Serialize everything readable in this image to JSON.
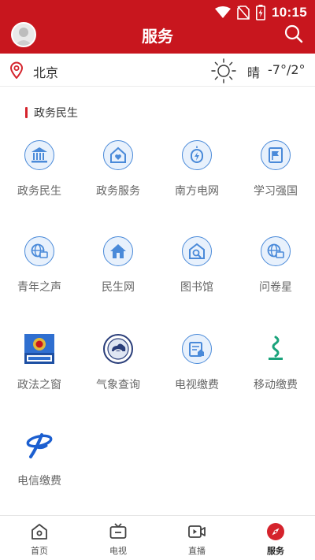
{
  "status_bar": {
    "time": "10:15",
    "icons": [
      "wifi-icon",
      "no-sim-icon",
      "battery-charging-icon"
    ]
  },
  "header": {
    "title": "服务",
    "avatar_icon": "avatar",
    "search_icon": "search-icon",
    "color": "#c8161e"
  },
  "weather": {
    "city": "北京",
    "condition": "晴",
    "temperature": "-7°/2°",
    "icon": "sun-icon"
  },
  "section": {
    "title": "政务民生"
  },
  "services": [
    {
      "label": "政务民生",
      "icon": "government-building-icon"
    },
    {
      "label": "政务服务",
      "icon": "home-heart-icon"
    },
    {
      "label": "南方电网",
      "icon": "power-grid-icon"
    },
    {
      "label": "学习强国",
      "icon": "study-flag-icon"
    },
    {
      "label": "青年之声",
      "icon": "globe-screen-icon"
    },
    {
      "label": "民生网",
      "icon": "house-icon"
    },
    {
      "label": "图书馆",
      "icon": "library-search-icon"
    },
    {
      "label": "问卷星",
      "icon": "globe-screen-icon"
    },
    {
      "label": "政法之窗",
      "icon": "police-emblem-icon"
    },
    {
      "label": "气象查询",
      "icon": "meteorology-logo-icon"
    },
    {
      "label": "电视缴费",
      "icon": "tv-bill-icon"
    },
    {
      "label": "移动缴费",
      "icon": "china-mobile-logo-icon"
    },
    {
      "label": "电信缴费",
      "icon": "china-telecom-logo-icon"
    }
  ],
  "tabs": [
    {
      "label": "首页",
      "icon": "home-icon",
      "active": false
    },
    {
      "label": "电视",
      "icon": "tv-icon",
      "active": false
    },
    {
      "label": "直播",
      "icon": "live-video-icon",
      "active": false
    },
    {
      "label": "服务",
      "icon": "compass-icon",
      "active": true
    }
  ]
}
